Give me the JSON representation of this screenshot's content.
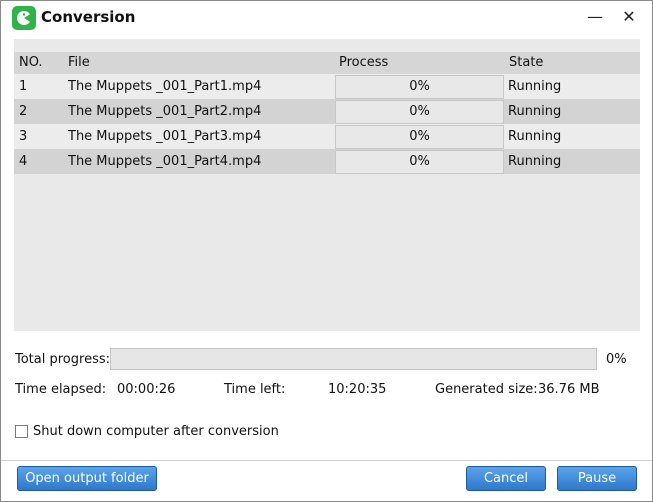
{
  "window": {
    "title": "Conversion",
    "app_icon": "app-logo-icon"
  },
  "controls": {
    "minimize": "—",
    "close": "✕"
  },
  "table": {
    "headers": {
      "no": "NO.",
      "file": "File",
      "process": "Process",
      "state": "State"
    },
    "rows": [
      {
        "no": "1",
        "file": "The Muppets _001_Part1.mp4",
        "process": "0%",
        "state": "Running"
      },
      {
        "no": "2",
        "file": "The Muppets _001_Part2.mp4",
        "process": "0%",
        "state": "Running"
      },
      {
        "no": "3",
        "file": "The Muppets _001_Part3.mp4",
        "process": "0%",
        "state": "Running"
      },
      {
        "no": "4",
        "file": "The Muppets _001_Part4.mp4",
        "process": "0%",
        "state": "Running"
      }
    ]
  },
  "total": {
    "label": "Total progress:",
    "percent_text": "0%",
    "fraction": 0
  },
  "stats": {
    "elapsed_label": "Time elapsed:",
    "elapsed_value": "00:00:26",
    "left_label": "Time left:",
    "left_value": "10:20:35",
    "size_label": "Generated size:",
    "size_value": "36.76 MB"
  },
  "shutdown": {
    "label": "Shut down computer after conversion",
    "checked": false
  },
  "buttons": {
    "open_folder": "Open output folder",
    "cancel": "Cancel",
    "pause": "Pause"
  },
  "colors": {
    "accent": "#2f78cc",
    "app_icon": "#2fb34a"
  }
}
